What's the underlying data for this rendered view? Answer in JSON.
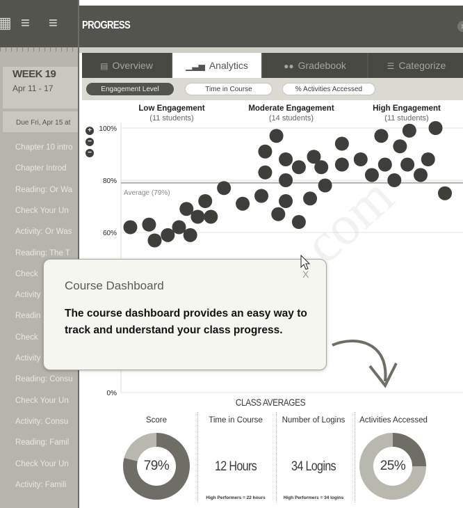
{
  "sidebar": {
    "week_label": "WEEK 19",
    "week_dates": "Apr 11 - 17",
    "due_label": "Due Fri, Apr 15 at",
    "items": [
      "Chapter 10 intro",
      "Chapter Introd",
      "Reading: Or Wa",
      "Check Your Un",
      "Activity: Or Was",
      "Reading: The T",
      "Check",
      "Activity",
      "Readin",
      "Check",
      "Activity",
      "Reading: Consu",
      "Check Your Un",
      "Activity: Consu",
      "Reading: Famil",
      "Check Your Un",
      "Activity: Famili"
    ]
  },
  "panel": {
    "title": "PROGRESS",
    "close_glyph": "x"
  },
  "tabs": [
    {
      "label": "Overview",
      "icon": "document-icon",
      "active": false
    },
    {
      "label": "Analytics",
      "icon": "bar-chart-icon",
      "active": true
    },
    {
      "label": "Gradebook",
      "icon": "users-icon",
      "active": false
    },
    {
      "label": "Categorize",
      "icon": "sliders-icon",
      "active": false
    }
  ],
  "filters": [
    {
      "label": "Engagement Level",
      "active": true
    },
    {
      "label": "Time in Course",
      "active": false
    },
    {
      "label": "% Activities Accessed",
      "active": false
    }
  ],
  "tooltip": {
    "title": "Course Dashboard",
    "text": "The course dashboard provides an easy way to track and understand your class progress.",
    "close": "X"
  },
  "averages": {
    "title": "CLASS AVERAGES",
    "columns": [
      {
        "header": "Score",
        "value": "79%",
        "ring_percent": 79
      },
      {
        "header": "Time in Course",
        "value": "12 Hours",
        "note": "High Performers = 22 hours"
      },
      {
        "header": "Number of Logins",
        "value": "34 Logins",
        "note": "High Performers = 34 logins"
      },
      {
        "header": "Activities Accessed",
        "value": "25%",
        "ring_percent": 25
      }
    ]
  },
  "watermark": "pna.com",
  "colors": {
    "dot": "#3e3e3a",
    "header": "#54544e",
    "ring": "#6e6e66",
    "ring_light": "#b8b8ae"
  },
  "chart_data": {
    "type": "scatter",
    "ylim": [
      0,
      100
    ],
    "yticks": [
      "100%",
      "80%",
      "60%",
      "0%"
    ],
    "average": {
      "label": "Average (79%)",
      "value": 79
    },
    "groups": [
      {
        "name": "Low Engagement",
        "count": "(11 students)"
      },
      {
        "name": "Moderate Engagement",
        "count": "(14 students)"
      },
      {
        "name": "High Engagement",
        "count": "(11 students)"
      }
    ],
    "points": [
      {
        "x": 1,
        "y": 62
      },
      {
        "x": 2,
        "y": 63
      },
      {
        "x": 2.3,
        "y": 57
      },
      {
        "x": 3,
        "y": 59
      },
      {
        "x": 3.6,
        "y": 62
      },
      {
        "x": 4,
        "y": 69
      },
      {
        "x": 4.2,
        "y": 59
      },
      {
        "x": 4.6,
        "y": 66
      },
      {
        "x": 5,
        "y": 72
      },
      {
        "x": 5.3,
        "y": 66
      },
      {
        "x": 6,
        "y": 77
      },
      {
        "x": 7,
        "y": 71
      },
      {
        "x": 8,
        "y": 74
      },
      {
        "x": 8.2,
        "y": 83
      },
      {
        "x": 8.2,
        "y": 91
      },
      {
        "x": 8.8,
        "y": 97
      },
      {
        "x": 8.9,
        "y": 67
      },
      {
        "x": 9.3,
        "y": 80
      },
      {
        "x": 9.3,
        "y": 72
      },
      {
        "x": 9.3,
        "y": 88
      },
      {
        "x": 10,
        "y": 64
      },
      {
        "x": 10,
        "y": 85
      },
      {
        "x": 10.6,
        "y": 73
      },
      {
        "x": 10.8,
        "y": 89
      },
      {
        "x": 11.2,
        "y": 85
      },
      {
        "x": 11.4,
        "y": 78
      },
      {
        "x": 12.3,
        "y": 94
      },
      {
        "x": 12.3,
        "y": 86
      },
      {
        "x": 13.3,
        "y": 88
      },
      {
        "x": 13.9,
        "y": 82
      },
      {
        "x": 14.4,
        "y": 97
      },
      {
        "x": 14.6,
        "y": 86
      },
      {
        "x": 15.1,
        "y": 80
      },
      {
        "x": 15.4,
        "y": 93
      },
      {
        "x": 15.9,
        "y": 99
      },
      {
        "x": 15.8,
        "y": 86
      },
      {
        "x": 16.5,
        "y": 82
      },
      {
        "x": 16.9,
        "y": 88
      },
      {
        "x": 17.3,
        "y": 100
      },
      {
        "x": 17.8,
        "y": 75
      }
    ]
  }
}
